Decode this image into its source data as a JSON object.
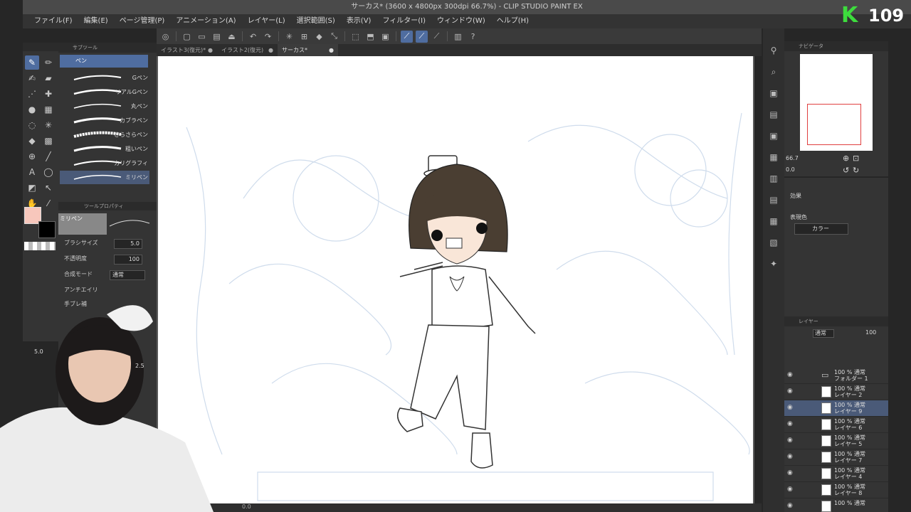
{
  "window": {
    "title": "サーカス* (3600 x 4800px 300dpi 66.7%) - CLIP STUDIO PAINT EX"
  },
  "menu": [
    "ファイル(F)",
    "編集(E)",
    "ページ管理(P)",
    "アニメーション(A)",
    "レイヤー(L)",
    "選択範囲(S)",
    "表示(V)",
    "フィルター(I)",
    "ウィンドウ(W)",
    "ヘルプ(H)"
  ],
  "tabs": [
    {
      "label": "イラスト3(復元)*"
    },
    {
      "label": "イラスト2(復元)"
    },
    {
      "label": "サーカス*"
    }
  ],
  "subtool": {
    "header": "サブツール",
    "group": "ペン",
    "brushes": [
      "Gペン",
      "リアルGペン",
      "丸ペン",
      "カブラペン",
      "さらさらペン",
      "粗いペン",
      "カリグラフィ",
      "ミリペン"
    ]
  },
  "tool_property": {
    "header": "ツールプロパティ",
    "brush_name": "ミリペン",
    "brush_size_label": "ブラシサイズ",
    "brush_size_value": "5.0",
    "opacity_label": "不透明度",
    "opacity_value": "100",
    "blend_label": "合成モード",
    "blend_value": "通常",
    "antialias_label": "アンチエイリ",
    "stabilize_label": "手ブレ補"
  },
  "colors": {
    "main": "#f7c7bc",
    "sub": "#000000",
    "accent": "#4f6da0"
  },
  "navigator": {
    "header": "ナビゲータ",
    "zoom": "66.7",
    "rotate": "0.0"
  },
  "effects": {
    "header": "効果",
    "display_color_label": "表現色",
    "display_color_value": "カラー"
  },
  "layer_panel": {
    "header": "レイヤー",
    "blend": "通常",
    "opacity": "100",
    "layers": [
      {
        "line1": "100 % 通常",
        "line2": "フォルダー 1",
        "selected": false
      },
      {
        "line1": "100 % 通常",
        "line2": "レイヤー 2",
        "selected": false
      },
      {
        "line1": "100 % 通常",
        "line2": "レイヤー 9",
        "selected": true
      },
      {
        "line1": "100 % 通常",
        "line2": "レイヤー 6",
        "selected": false
      },
      {
        "line1": "100 % 通常",
        "line2": "レイヤー 5",
        "selected": false
      },
      {
        "line1": "100 % 通常",
        "line2": "レイヤー 7",
        "selected": false
      },
      {
        "line1": "100 % 通常",
        "line2": "レイヤー 4",
        "selected": false
      },
      {
        "line1": "100 % 通常",
        "line2": "レイヤー 8",
        "selected": false
      },
      {
        "line1": "100 % 通常",
        "line2": "",
        "selected": false
      }
    ]
  },
  "status": {
    "zoom": "0.0"
  },
  "overlay": {
    "logo_text": "109",
    "logo_letter": "K",
    "webcam_size_a": "5.0",
    "webcam_size_b": "2.5"
  }
}
